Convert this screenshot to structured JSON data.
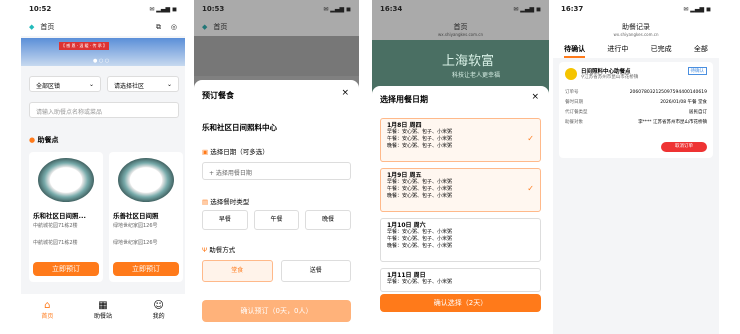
{
  "p1": {
    "time": "10:52",
    "nav_title": "首页",
    "banner_text": "【 感 恩 · 温 暖 · 传 承 】",
    "filter_area": "全部区镇",
    "filter_community": "请选择社区",
    "search_ph": "请输入助餐点名称或菜品",
    "section_title": "助餐点",
    "cards": [
      {
        "name": "乐和社区日间照...",
        "addr1": "中航城花园71栋2楼",
        "addr2": "中航城花园71栋2楼",
        "btn": "立即预订"
      },
      {
        "name": "乐善社区日间照",
        "addr1": "绿地世纪家园126号",
        "addr2": "绿地世纪家园126号",
        "btn": "立即预订"
      }
    ],
    "tabs": [
      "首页",
      "助餐站",
      "我的"
    ]
  },
  "p2": {
    "time": "10:53",
    "nav_title": "首页",
    "sheet_title": "预订餐食",
    "center": "乐和社区日间照料中心",
    "date_label": "选择日期（可多选）",
    "date_btn": "+ 选择用餐日期",
    "meal_label": "选择餐时类型",
    "meals": [
      "早餐",
      "午餐",
      "晚餐"
    ],
    "mode_label": "助餐方式",
    "modes": [
      "堂食",
      "送餐"
    ],
    "confirm": "确认预订（0天，0人）"
  },
  "p3": {
    "time": "16:34",
    "nav_title": "首页",
    "url": "wx.shiyangkes.com.cn",
    "banner": "上海软富",
    "banner2": "科技让老人更幸福",
    "sheet_title": "选择用餐日期",
    "days": [
      {
        "date": "1月8日 周四",
        "checked": true,
        "lines": [
          "早餐：安心粥、包子、小米粥",
          "午餐：安心粥、包子、小米粥",
          "晚餐：安心粥、包子、小米粥"
        ]
      },
      {
        "date": "1月9日 周五",
        "checked": true,
        "lines": [
          "早餐：安心粥、包子、小米粥",
          "午餐：安心粥、包子、小米粥",
          "晚餐：安心粥、包子、小米粥"
        ]
      },
      {
        "date": "1月10日 周六",
        "checked": false,
        "lines": [
          "早餐：安心粥、包子、小米粥",
          "午餐：安心粥、包子、小米粥",
          "晚餐：安心粥、包子、小米粥"
        ]
      },
      {
        "date": "1月11日 周日",
        "checked": false,
        "lines": [
          "早餐：安心粥、包子、小米粥"
        ]
      }
    ],
    "confirm": "确认选择（2天）"
  },
  "p4": {
    "time": "16:37",
    "nav_title": "助餐记录",
    "url": "wx.shiyangkes.com.cn",
    "tabs": [
      "待确认",
      "进行中",
      "已完成",
      "全部"
    ],
    "center": "日间照料中心助餐点",
    "center_addr": "江苏省苏州市昆山市花桥镇",
    "tag": "待确认",
    "rows": [
      {
        "k": "订单号",
        "v": "206078032125097594400140619"
      },
      {
        "k": "餐时日期",
        "v": "2026/01/08 午餐 堂食"
      },
      {
        "k": "代订餐类型",
        "v": "居民自订"
      },
      {
        "k": "助餐对象",
        "v": "李**** 江苏省苏州市昆山市花桥镇"
      }
    ],
    "cancel": "取消订单"
  }
}
